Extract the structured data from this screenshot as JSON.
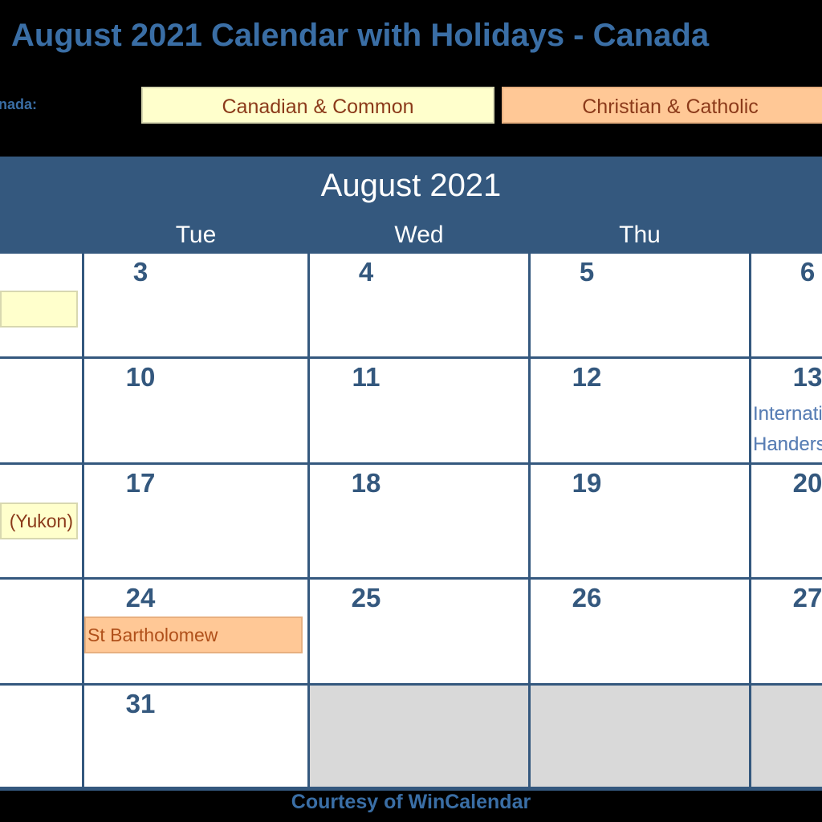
{
  "title": "August 2021 Calendar with Holidays - Canada",
  "legend": {
    "label": "nada:",
    "items": [
      {
        "label": "Canadian & Common",
        "color": "#ffffcc"
      },
      {
        "label": "Christian & Catholic",
        "color": "#ffc896"
      }
    ]
  },
  "calendar": {
    "month": "August 2021",
    "weekdays": [
      "Tue",
      "Wed",
      "Thu"
    ],
    "days": {
      "d3": "3",
      "d4": "4",
      "d5": "5",
      "d6": "6",
      "d10": "10",
      "d11": "11",
      "d12": "12",
      "d13": "13",
      "d17": "17",
      "d18": "18",
      "d19": "19",
      "d20": "20",
      "d24": "24",
      "d25": "25",
      "d26": "26",
      "d27": "27",
      "d31": "31"
    },
    "events": {
      "mon2": "",
      "mon16": "(Yukon)",
      "d13": "Internat­ional Left\nHanders",
      "d24": "St Bartholomew"
    }
  },
  "events_display": {
    "d13_line1": "Internat",
    "d13_line2": "Handers"
  },
  "footer": "Courtesy of WinCalendar"
}
